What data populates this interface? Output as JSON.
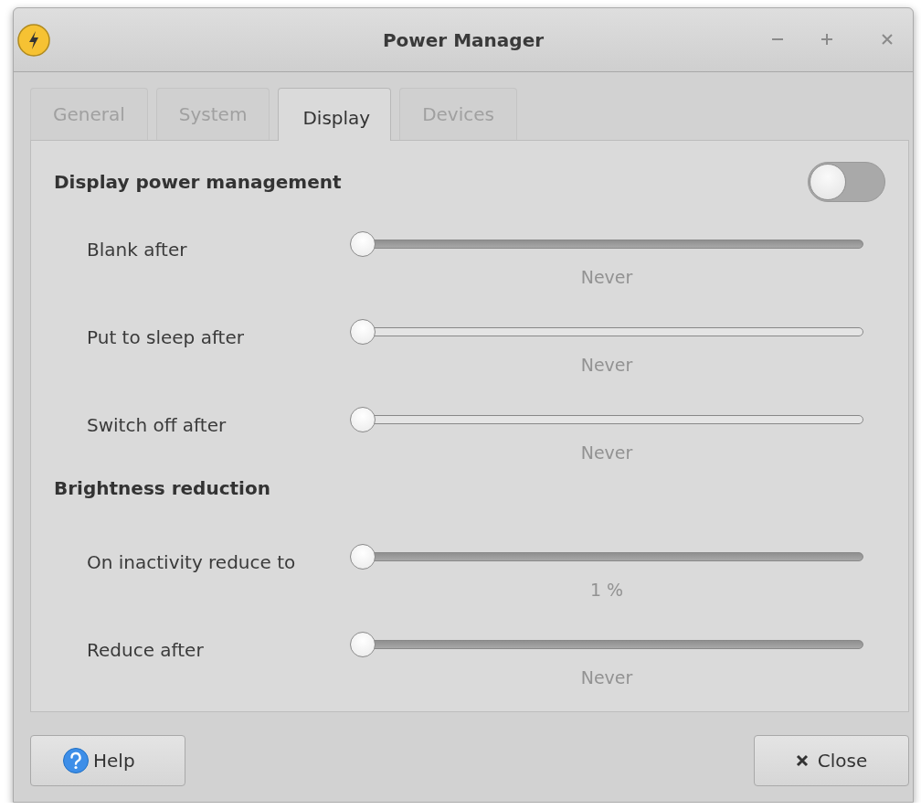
{
  "window": {
    "title": "Power Manager"
  },
  "tabs": [
    {
      "label": "General",
      "selected": false
    },
    {
      "label": "System",
      "selected": false
    },
    {
      "label": "Display",
      "selected": true
    },
    {
      "label": "Devices",
      "selected": false
    }
  ],
  "sections": [
    {
      "heading": "Display power management",
      "toggle": {
        "on": false
      },
      "rows": [
        {
          "label": "Blank after",
          "level": 0,
          "reading": "Never",
          "disabled": false
        },
        {
          "label": "Put to sleep after",
          "level": 0,
          "reading": "Never",
          "disabled": true
        },
        {
          "label": "Switch off after",
          "level": 0,
          "reading": "Never",
          "disabled": true
        }
      ]
    },
    {
      "heading": "Brightness reduction",
      "rows": [
        {
          "label": "On inactivity reduce to",
          "level": 0,
          "reading": "1 %",
          "disabled": false
        },
        {
          "label": "Reduce after",
          "level": 0,
          "reading": "Never",
          "disabled": false
        }
      ]
    }
  ],
  "buttons": [
    {
      "kind": "help",
      "label": "Help"
    },
    {
      "kind": "close",
      "label": "Close"
    }
  ]
}
